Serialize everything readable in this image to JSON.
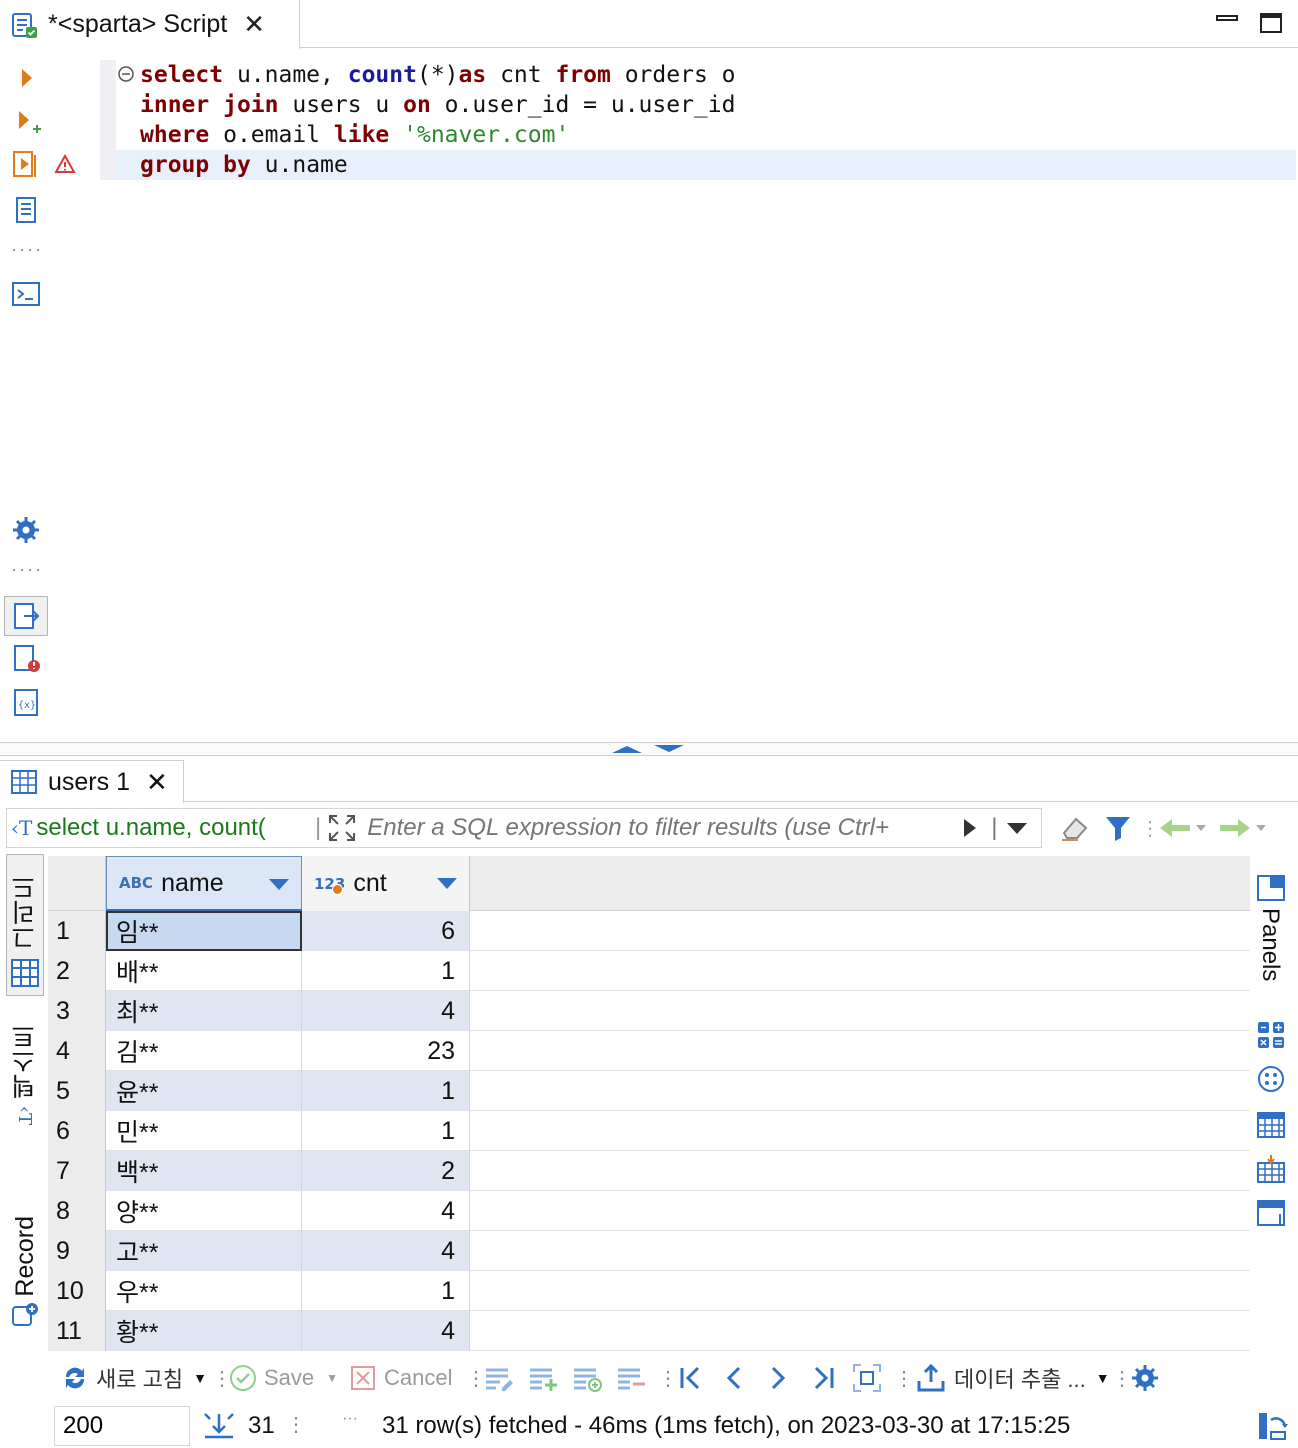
{
  "editor": {
    "tab_title": "*<sparta> Script",
    "code": {
      "l1": {
        "k_select": "select",
        "t1": " u.name, ",
        "f_count": "count",
        "t2": "(*)",
        "k_as": "as",
        "t3": " cnt ",
        "k_from": "from",
        "t4": " orders o"
      },
      "l2": {
        "k_inner": "inner",
        "t1": " ",
        "k_join": "join",
        "t2": " users u ",
        "k_on": "on",
        "t3": " o.user_id = u.user_id"
      },
      "l3": {
        "k_where": "where",
        "t1": " o.email ",
        "k_like": "like",
        "t2": " ",
        "s1": "'%naver.com'"
      },
      "l4": {
        "k_group": "group",
        "t1": " ",
        "k_by": "by",
        "t2": " u.name"
      }
    }
  },
  "results": {
    "tab_title": "users 1",
    "query_label": "select u.name, count(",
    "filter_placeholder": "Enter a SQL expression to filter results (use Ctrl+",
    "side_tabs": {
      "grid": "그리드",
      "text": "텍스트",
      "record": "Record"
    },
    "right_panel_label": "Panels",
    "columns": [
      {
        "type": "ABC",
        "name": "name"
      },
      {
        "type": "123",
        "name": "cnt"
      }
    ],
    "rows": [
      {
        "n": "1",
        "name": "임**",
        "cnt": "6"
      },
      {
        "n": "2",
        "name": "배**",
        "cnt": "1"
      },
      {
        "n": "3",
        "name": "최**",
        "cnt": "4"
      },
      {
        "n": "4",
        "name": "김**",
        "cnt": "23"
      },
      {
        "n": "5",
        "name": "윤**",
        "cnt": "1"
      },
      {
        "n": "6",
        "name": "민**",
        "cnt": "1"
      },
      {
        "n": "7",
        "name": "백**",
        "cnt": "2"
      },
      {
        "n": "8",
        "name": "양**",
        "cnt": "4"
      },
      {
        "n": "9",
        "name": "고**",
        "cnt": "4"
      },
      {
        "n": "10",
        "name": "우**",
        "cnt": "1"
      },
      {
        "n": "11",
        "name": "황**",
        "cnt": "4"
      }
    ],
    "toolbar": {
      "refresh": "새로 고침",
      "save": "Save",
      "cancel": "Cancel",
      "export": "데이터 추출 ..."
    },
    "status": {
      "fetch_size": "200",
      "row_count": "31",
      "ellipsis": "···",
      "message": "31 row(s) fetched - 46ms (1ms fetch), on 2023-03-30 at 17:15:25"
    }
  },
  "colors": {
    "keyword": "#7f0000",
    "function": "#1a1a9a",
    "string": "#2a8a2a",
    "accent": "#2f6fc4",
    "current_line": "#e8f1fb"
  }
}
